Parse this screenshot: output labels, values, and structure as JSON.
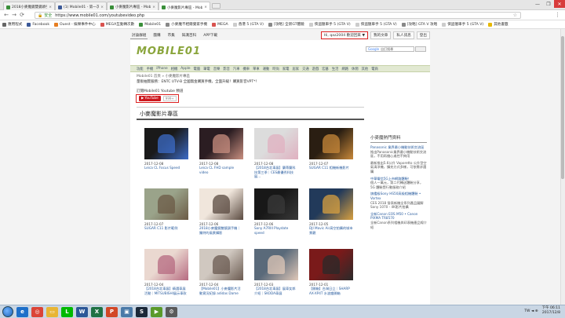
{
  "browser": {
    "tabs": [
      {
        "label": "2018小麥魔鏡雙鏡頭手機",
        "color": "#3a8f3a",
        "active": false
      },
      {
        "label": "(1) Mobile01 - 第一次",
        "color": "#3b5998",
        "active": false
      },
      {
        "label": "小麥魔影片專區 - Mobile01",
        "color": "#3a8f3a",
        "active": false
      },
      {
        "label": "小麥魔影片專區 - Mobi",
        "color": "#3a8f3a",
        "active": true
      }
    ],
    "window_controls": [
      "—",
      "❐",
      "✕"
    ],
    "secure_label": "安全",
    "url": "https://www.mobile01.com/youtubevideo.php",
    "star": "☆",
    "menu": "⋮",
    "back": "←",
    "forward": "→",
    "reload": "⟳",
    "bookmarks": [
      {
        "label": "應用程式",
        "color": "#666"
      },
      {
        "label": "Facebook",
        "color": "#3b5998"
      },
      {
        "label": "Ouest - 娛樂事件中心",
        "color": "#e67e22"
      },
      {
        "label": "MEGA互動轉次數",
        "color": "#d9534f"
      },
      {
        "label": "Mobile01",
        "color": "#3a8f3a"
      },
      {
        "label": "小麥魔不相爾覺家手機",
        "color": "#888"
      },
      {
        "label": "MEGA",
        "color": "#d9534f"
      },
      {
        "label": "香港 5 (GTA V)",
        "color": "#ccc"
      },
      {
        "label": "[攻略] 全新GT體驗",
        "color": "#888"
      },
      {
        "label": "俠盜獵車手 5 (GTA V)",
        "color": "#ccc"
      },
      {
        "label": "俠盜獵車手 5 (GTA V)",
        "color": "#ccc"
      },
      {
        "label": "[攻略] GTA V 攻略",
        "color": "#888"
      },
      {
        "label": "俠盜獵車手 5 (GTA V)",
        "color": "#ccc"
      },
      {
        "label": "其他書籤",
        "color": "#e6b800"
      }
    ]
  },
  "site": {
    "top_links": [
      "討論群組",
      "團購",
      "市集",
      "知識百科",
      "APP下載"
    ],
    "current_link_index": 0,
    "user_button": "Hi, qaz2004 歡迎回來 ▼",
    "right_links": [
      "我的文章",
      "私人訊息",
      "登出"
    ],
    "logo": "MOBILE01",
    "search_placeholder": "自訂搜尋",
    "search_logo": "Google",
    "categories": [
      "功能",
      "手機",
      "iPhone",
      "相機",
      "Apple",
      "電腦",
      "筆電",
      "音樂",
      "影音",
      "汽車",
      "機車",
      "單車",
      "運動",
      "時尚",
      "家電",
      "居家",
      "交通",
      "遊戲",
      "宏碁",
      "生活",
      "網路",
      "休閒",
      "其他",
      "電商"
    ],
    "breadcrumb": "Mobile01 首頁 » 小麥魔影片專區",
    "notice": "量販抽獎服務：ENTC UTV-B 全國無金購買手機，全面升級！購買影音VPT*！",
    "subscribe_label": "訂閱Mobile01 Youtube 頻道",
    "yt_button": "YouTube",
    "yt_count": "999+",
    "main_title": "小麥魔影片專區"
  },
  "videos": [
    {
      "date": "2017-12-08",
      "title": "Leica CL Focus Speed",
      "bg": "#1a1a1a",
      "accent": "#3c6cc8"
    },
    {
      "date": "2017-12-08",
      "title": "Leica CL FHD sample video",
      "bg": "#2b1d22",
      "accent": "#c98f80"
    },
    {
      "date": "2017-12-08",
      "title": "【2018台北車展】蘭蒂蘭科技第三季｜CES最優秀科技展...",
      "bg": "#dcdcdc",
      "accent": "#e0b0c0"
    },
    {
      "date": "2017-12-07",
      "title": "SUGAR C11 相機新機影片",
      "bg": "#2a1e12",
      "accent": "#c8883a"
    },
    {
      "date": "2017-12-07",
      "title": "SUGAR C11 影片範例",
      "bg": "#9aa38a",
      "accent": "#6b5a45"
    },
    {
      "date": "2017-12-06",
      "title": "2018小麥魔鏡雙鏡頭手機｜獨特的風景攝影",
      "bg": "#f0e6dc",
      "accent": "#5a4a40"
    },
    {
      "date": "2017-12-06",
      "title": "Sony A7RIII Playdate speed",
      "bg": "#181818",
      "accent": "#3a3a3a"
    },
    {
      "date": "2017-12-05",
      "title": "DJI Mavic Air高空拍攝的城市景觀",
      "bg": "#223a5a",
      "accent": "#d8a040"
    },
    {
      "date": "2017-12-04",
      "title": "【2018台北車展】精選車展活動｜MITSUBISHI展示車款",
      "bg": "#ead8d0",
      "accent": "#b66a80"
    },
    {
      "date": "2017-12-04",
      "title": "【Mobile01】小麥魔影片活動實況紀錄 adidas Dame",
      "bg": "#d0c8c0",
      "accent": "#6a5a50"
    },
    {
      "date": "2017-12-03",
      "title": "【2018台北車展】展車女郎介紹｜SKODA車展",
      "bg": "#5a6a7a",
      "accent": "#e0c8b8"
    },
    {
      "date": "2017-12-01",
      "title": "【開箱】台灣日立｜SHARP AX-XP4T 水波爐開箱",
      "bg": "#7a1a1a",
      "accent": "#2a2a2a"
    }
  ],
  "sidebar": {
    "title": "小麥魔熱門資料",
    "items": [
      {
        "head": "Panasonic 業界最小機動技術交流區",
        "body": "推出Panasonic業界最小機動技術交流區，不用再擔心遙控不夠用"
      },
      {
        "head": "",
        "body": "最新推出5.6公升 Vaporetto 公升型空氣清淨機，擴充方式多樣，可依需求選購"
      },
      {
        "head": "中華電信5G上市網路體驗！",
        "body": "個人一萬元，第二代轉送體驗分享，5G 體驗暨行動服務介紹"
      },
      {
        "head": "旗艦級Sony HS50高級相機體驗 • Vortex",
        "body": "CES 2018 發表新機全系列產品圖解 Sony 1070 - 4K影片拍攝"
      },
      {
        "head": "全新Canon EOS M50 • Canon PIXMA TR8570",
        "body": "全新Canon系列相機與印表機產品線介紹"
      }
    ]
  },
  "taskbar": {
    "apps": [
      {
        "name": "ie",
        "glyph": "e",
        "color": "#1e6fc9"
      },
      {
        "name": "chrome",
        "glyph": "◎",
        "color": "#db4437"
      },
      {
        "name": "explorer",
        "glyph": "▭",
        "color": "#e8b534"
      },
      {
        "name": "line",
        "glyph": "L",
        "color": "#00b900"
      },
      {
        "name": "word",
        "glyph": "W",
        "color": "#2b5797"
      },
      {
        "name": "excel",
        "glyph": "X",
        "color": "#1f7244"
      },
      {
        "name": "powerpoint",
        "glyph": "P",
        "color": "#d24726"
      },
      {
        "name": "photos",
        "glyph": "▣",
        "color": "#4a7aa8"
      },
      {
        "name": "steam",
        "glyph": "S",
        "color": "#1b2838"
      },
      {
        "name": "media",
        "glyph": "▶",
        "color": "#5a9a2a"
      },
      {
        "name": "tool",
        "glyph": "⚙",
        "color": "#5a5a5a"
      }
    ],
    "tray": "TW ◄ ⊕",
    "time": "下午 06:11",
    "date": "2017/12/8"
  }
}
